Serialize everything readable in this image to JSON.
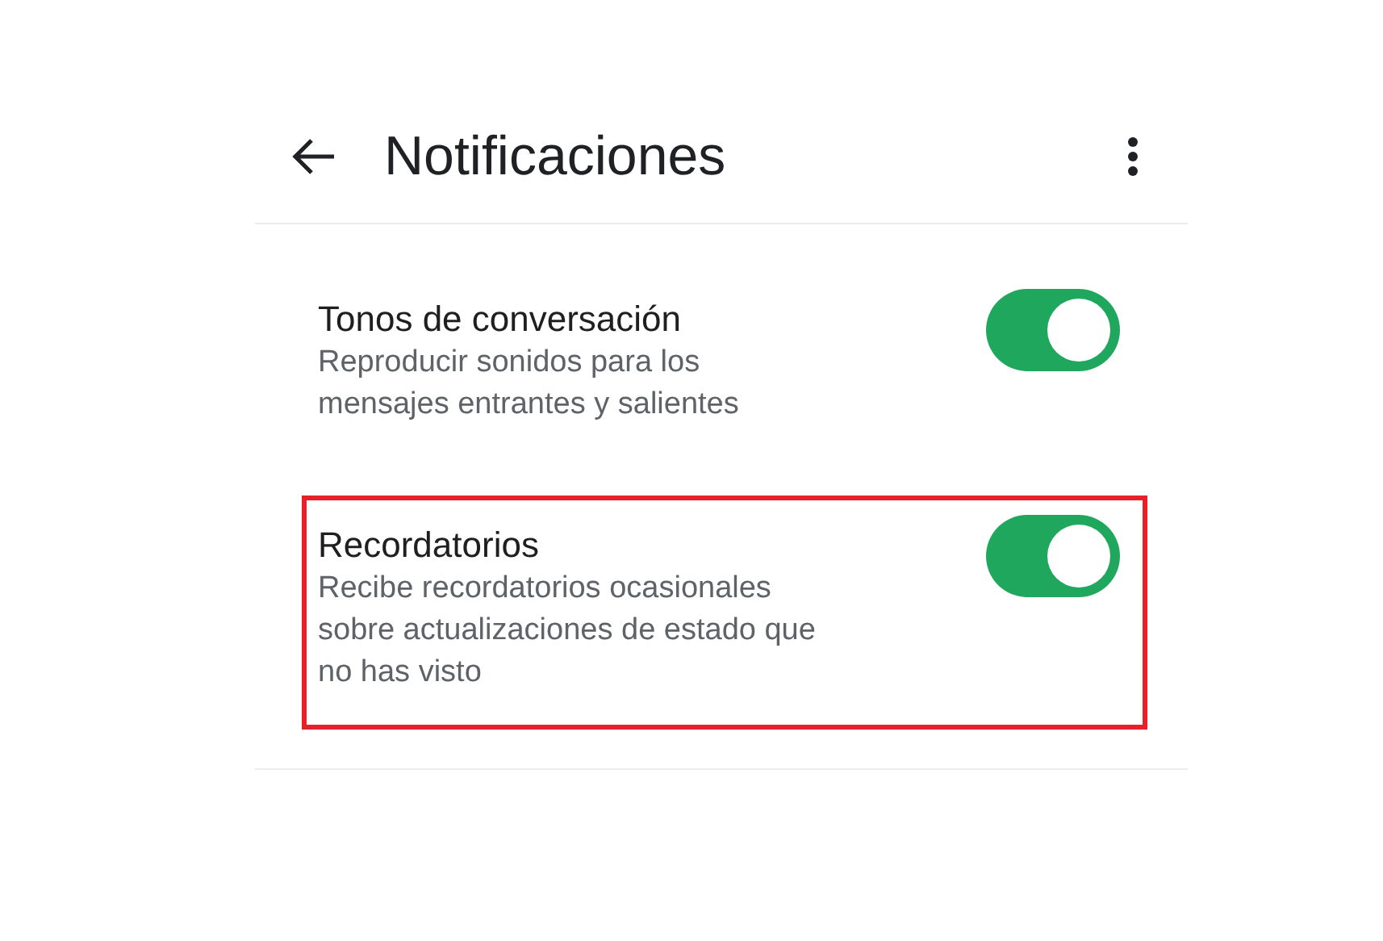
{
  "header": {
    "title": "Notificaciones"
  },
  "settings": [
    {
      "title": "Tonos de conversación",
      "description": "Reproducir sonidos para los\nmensajes entrantes y salientes",
      "on": true,
      "highlighted": false
    },
    {
      "title": "Recordatorios",
      "description": "Recibe recordatorios ocasionales\nsobre actualizaciones de estado que\nno has visto",
      "on": true,
      "highlighted": true
    }
  ]
}
